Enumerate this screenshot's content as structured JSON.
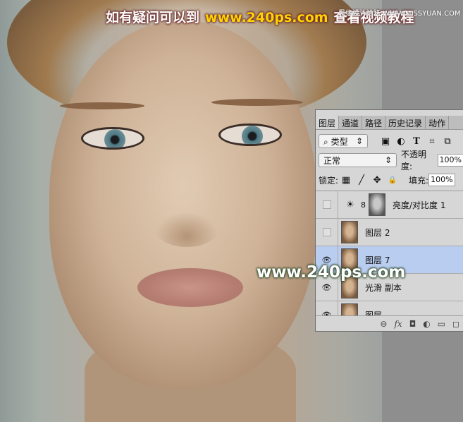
{
  "banner": {
    "left": "如有疑问可以到",
    "url": "www.240ps.com",
    "right": "查看视频教程",
    "corner": "思缘设计论坛 WWW.MISSYUAN.COM"
  },
  "watermark": "www.240ps.com",
  "panel": {
    "tabs": [
      "图层",
      "通道",
      "路径",
      "历史记录",
      "动作"
    ],
    "active_tab": "图层",
    "filter": {
      "label": "类型",
      "icon": "search-icon"
    },
    "filter_icons": [
      "image-icon",
      "adjustment-icon",
      "text-icon",
      "shape-icon",
      "smart-object-icon"
    ],
    "blend_mode": "正常",
    "opacity_label": "不透明度:",
    "opacity": "100%",
    "lock_label": "锁定:",
    "fill_label": "填充:",
    "fill": "100%",
    "layers": [
      {
        "name": "亮度/对比度 1",
        "visible": false,
        "type": "adjustment"
      },
      {
        "name": "图层 2",
        "visible": false
      },
      {
        "name": "图层 7",
        "visible": true,
        "selected": true
      },
      {
        "name": "光滑 副本",
        "visible": true
      },
      {
        "name": "图层",
        "visible": true
      }
    ],
    "bottom_icons": [
      "link-icon",
      "fx-icon",
      "mask-icon",
      "adjustment-layer-icon",
      "folder-icon",
      "new-layer-icon"
    ],
    "glyphs": {
      "eye": "👁",
      "sun": "☀",
      "chain": "8",
      "link": "⊖",
      "fx": "fx",
      "mask": "◘",
      "adj": "◐",
      "folder": "▭",
      "new": "◻",
      "lock_px": "▦",
      "brush": "╱",
      "move": "✥",
      "lock": "🔒",
      "img": "▣",
      "circle": "◐",
      "text": "T",
      "shape": "⌗",
      "smart": "⧉",
      "search": "⌕",
      "updown": "⇕"
    }
  }
}
